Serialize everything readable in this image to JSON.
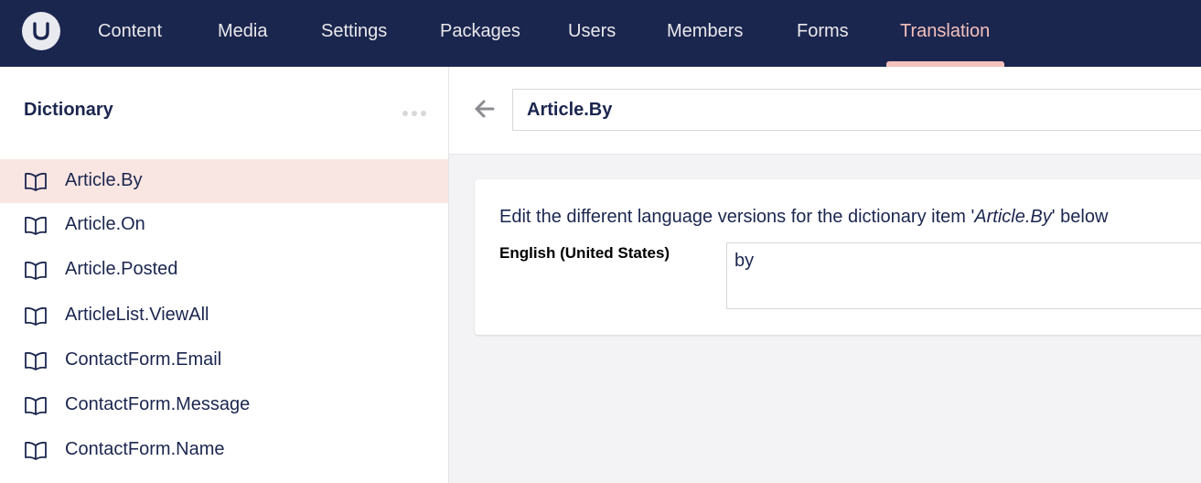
{
  "nav": {
    "items": [
      {
        "label": "Content"
      },
      {
        "label": "Media"
      },
      {
        "label": "Settings"
      },
      {
        "label": "Packages"
      },
      {
        "label": "Users"
      },
      {
        "label": "Members"
      },
      {
        "label": "Forms"
      },
      {
        "label": "Translation",
        "active": true
      }
    ]
  },
  "sidebar": {
    "title": "Dictionary",
    "items": [
      {
        "label": "Article.By",
        "icon": "book-icon",
        "active": true
      },
      {
        "label": "Article.On",
        "icon": "book-icon"
      },
      {
        "label": "Article.Posted",
        "icon": "book-icon"
      },
      {
        "label": "ArticleList.ViewAll",
        "icon": "book-icon"
      },
      {
        "label": "ContactForm.Email",
        "icon": "book-icon"
      },
      {
        "label": "ContactForm.Message",
        "icon": "book-icon"
      },
      {
        "label": "ContactForm.Name",
        "icon": "book-icon"
      }
    ]
  },
  "editor": {
    "item_name": "Article.By",
    "description_prefix": "Edit the different language versions for the dictionary item '",
    "description_item": "Article.By",
    "description_suffix": "' below",
    "languages": [
      {
        "label": "English (United States)",
        "value": "by"
      }
    ]
  },
  "colors": {
    "topbar": "#1b264f",
    "accent": "#f5c1bc",
    "active_row": "#f9e5e2",
    "text": "#1b264f"
  }
}
